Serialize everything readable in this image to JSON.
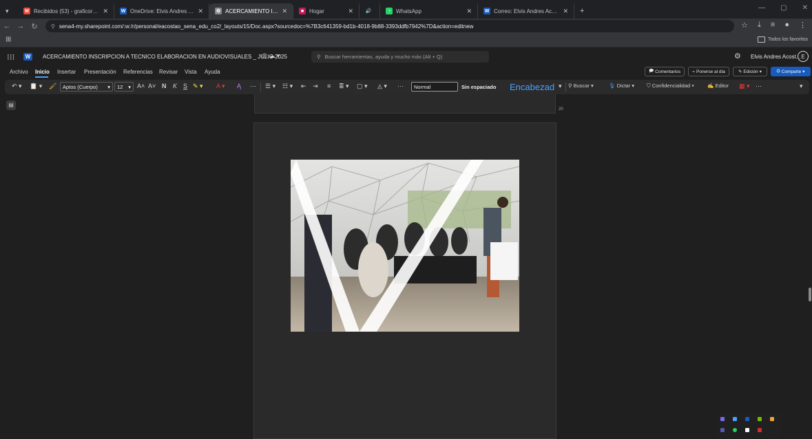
{
  "browser": {
    "tabs": [
      {
        "label": "Recibidos (53) - graficorelvisaco",
        "icon": "gmail-icon",
        "color": "#ea4335",
        "glyph": "M",
        "active": false
      },
      {
        "label": "OneDrive: Elvis Andres Acosta",
        "icon": "word-icon",
        "color": "#185abd",
        "glyph": "W",
        "active": false
      },
      {
        "label": "ACERCAMIENTO INSCRIPCION",
        "icon": "sharepoint-icon",
        "color": "#888888",
        "glyph": "⚙",
        "active": true
      },
      {
        "label": "Hogar",
        "icon": "app-icon",
        "color": "#c2185b",
        "glyph": "■",
        "active": false
      },
      {
        "label": "",
        "icon": "audio-icon",
        "color": "#202124",
        "glyph": "🔊",
        "active": false
      },
      {
        "label": "WhatsApp",
        "icon": "whatsapp-icon",
        "color": "#25d366",
        "glyph": "◔",
        "active": false
      },
      {
        "label": "Correo: Elvis Andres Acosta Os",
        "icon": "outlook-icon",
        "color": "#185abd",
        "glyph": "W",
        "active": false
      }
    ],
    "new_tab": "+",
    "url": "sena4-my.sharepoint.com/:w:/r/personal/eacostao_sena_edu_co2/_layouts/15/Doc.aspx?sourcedoc=%7B3c641359-bd1b-4018-9b88-3393ddfb7942%7D&action=editnew",
    "bookmarks_folder": "Todos los favoritos"
  },
  "word": {
    "doc_title": "ACERCAMIENTO INSCRIPCION A TECNICO ELABORACION EN AUDIOVISUALES _ JULIO 2025",
    "search_placeholder": "Buscar herramientas, ayuda y mucho más (Alt + Q)",
    "user_name": "Elvis Andres Acost...",
    "avatar_initial": "E",
    "menus": [
      "Archivo",
      "Inicio",
      "Insertar",
      "Presentación",
      "Referencias",
      "Revisar",
      "Vista",
      "Ayuda"
    ],
    "right_buttons": {
      "comments": "Comentarios",
      "catch_up": "Ponerse al día",
      "editing": "Edición",
      "share": "Comparte"
    },
    "ribbon": {
      "font": "Aptos (Cuerpo)",
      "size": "12",
      "style_normal": "Normal",
      "style_nospacing": "Sin espaciado",
      "style_heading": "Encabezad",
      "find": "Buscar",
      "dictate": "Dictar",
      "sensitivity": "Confidencialidad",
      "editor": "Editor"
    },
    "page_number": "20"
  },
  "colors": {
    "accent": "#185abd",
    "underline": "#4aa0ff"
  }
}
